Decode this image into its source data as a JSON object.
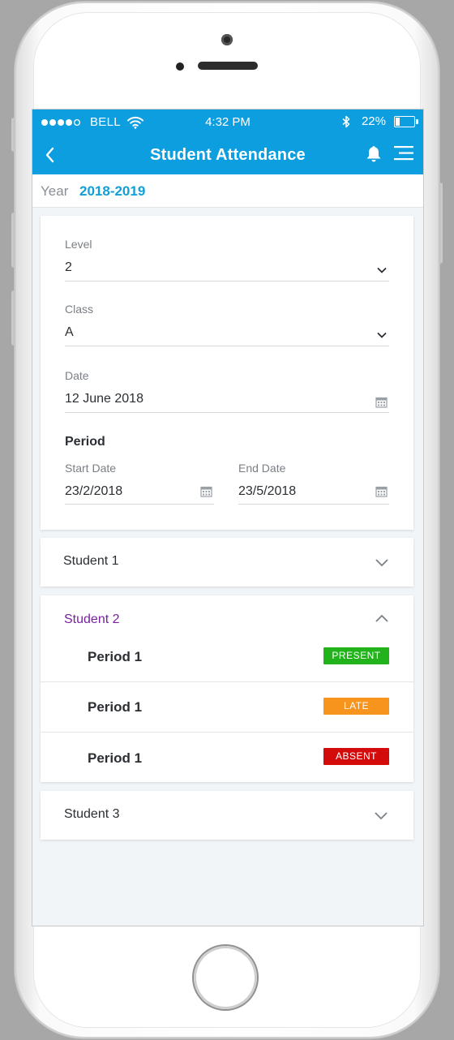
{
  "status_bar": {
    "carrier": "BELL",
    "time": "4:32 PM",
    "battery": "22%",
    "battery_level": 0.22,
    "signal_dots_filled": 4,
    "signal_dots_total": 5
  },
  "nav": {
    "title": "Student Attendance",
    "icons": [
      "back-icon",
      "bell-icon",
      "menu-icon"
    ]
  },
  "year": {
    "label": "Year",
    "value": "2018-2019"
  },
  "form": {
    "level": {
      "label": "Level",
      "value": "2"
    },
    "class": {
      "label": "Class",
      "value": "A"
    },
    "date": {
      "label": "Date",
      "value": "12 June 2018"
    },
    "period": {
      "title": "Period",
      "start": {
        "label": "Start Date",
        "value": "23/2/2018"
      },
      "end": {
        "label": "End Date",
        "value": "23/5/2018"
      }
    }
  },
  "students": [
    {
      "name": "Student 1",
      "expanded": false
    },
    {
      "name": "Student 2",
      "expanded": true,
      "periods": [
        {
          "label": "Period 1",
          "status": "PRESENT",
          "color": "#22b31c"
        },
        {
          "label": "Period 1",
          "status": "LATE",
          "color": "#f7941d"
        },
        {
          "label": "Period 1",
          "status": "ABSENT",
          "color": "#d30b0b"
        }
      ]
    },
    {
      "name": "Student 3",
      "expanded": false
    }
  ],
  "colors": {
    "primary": "#0d9ee0",
    "year_value": "#129ed6",
    "expanded_student": "#7b1fa2"
  }
}
